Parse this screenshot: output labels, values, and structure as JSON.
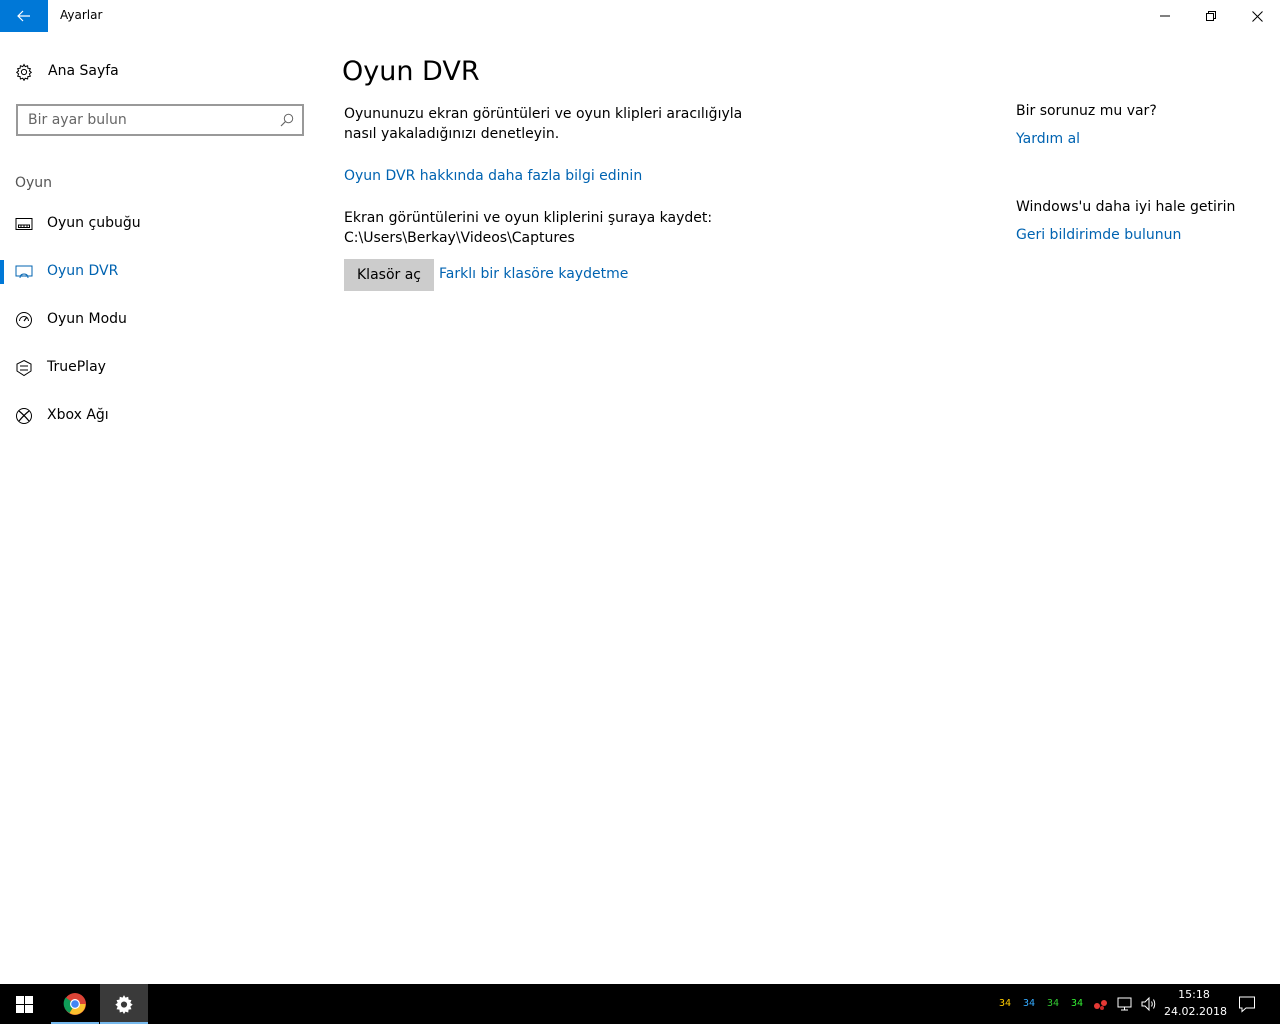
{
  "window": {
    "title": "Ayarlar"
  },
  "sidebar": {
    "home_label": "Ana Sayfa",
    "search_placeholder": "Bir ayar bulun",
    "section_label": "Oyun",
    "items": [
      {
        "label": "Oyun çubuğu",
        "icon": "game-bar-icon"
      },
      {
        "label": "Oyun DVR",
        "icon": "game-dvr-icon",
        "active": true
      },
      {
        "label": "Oyun Modu",
        "icon": "game-mode-icon"
      },
      {
        "label": "TruePlay",
        "icon": "trueplay-icon"
      },
      {
        "label": "Xbox Ağı",
        "icon": "xbox-icon"
      }
    ]
  },
  "main": {
    "title": "Oyun DVR",
    "description": "Oyununuzu ekran görüntüleri ve oyun klipleri aracılığıyla nasıl yakaladığınızı denetleyin.",
    "learn_more_link": "Oyun DVR hakkında daha fazla bilgi edinin",
    "save_path_text": "Ekran görüntülerini ve oyun kliplerini şuraya kaydet: C:\\Users\\Berkay\\Videos\\Captures",
    "open_folder_button": "Klasör aç",
    "change_folder_link": "Farklı bir klasöre kaydetme"
  },
  "right_panel": {
    "help_question": "Bir sorunuz mu var?",
    "help_link": "Yardım al",
    "feedback_question": "Windows'u daha iyi hale getirin",
    "feedback_link": "Geri bildirimde bulunun"
  },
  "taskbar": {
    "tray_numbers": [
      "34",
      "34",
      "34",
      "34"
    ],
    "tray_colors": [
      "#ffcc00",
      "#33aaff",
      "#33cc33",
      "#33ee33"
    ],
    "time": "15:18",
    "date": "24.02.2018"
  },
  "colors": {
    "accent": "#0078d7",
    "link": "#0063b1",
    "taskbar": "#000000"
  }
}
